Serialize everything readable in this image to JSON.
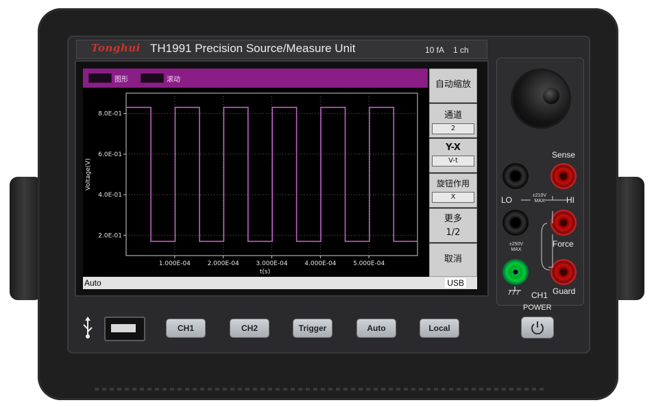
{
  "device": {
    "brand": "Tonghui",
    "model_title": "TH1991 Precision Source/Measure Unit",
    "spec_current": "10 fA",
    "spec_channels": "1 ch"
  },
  "screen": {
    "tabs": [
      {
        "label": "图形"
      },
      {
        "label": "滚动"
      }
    ],
    "status_left": "Auto",
    "status_right": "USB"
  },
  "softkeys": {
    "autoscale": "自动缩放",
    "channel": {
      "label": "通道",
      "value": "2"
    },
    "yx": {
      "label": "Y-X",
      "value": "V-t"
    },
    "knob_function": {
      "label": "旋钮作用",
      "value": "X"
    },
    "more_line1": "更多",
    "more_line2": "1/2",
    "cancel": "取消"
  },
  "chart_data": {
    "type": "line",
    "xlabel": "t(s)",
    "ylabel": "Voltage(V)",
    "x_ticks": [
      "1.000E-04",
      "2.000E-04",
      "3.000E-04",
      "4.000E-04",
      "5.000E-04"
    ],
    "y_ticks": [
      "2.0E-01",
      "4.0E-01",
      "6.0E-01",
      "8.0E-01"
    ],
    "xlim": [
      0,
      0.0006
    ],
    "ylim": [
      0.1,
      0.9
    ],
    "series": [
      {
        "color": "#c062c3",
        "x": [
          0,
          5.1e-05,
          5.1e-05,
          0.000101,
          0.000101,
          0.000151,
          0.000151,
          0.000201,
          0.000201,
          0.000251,
          0.000251,
          0.000301,
          0.000301,
          0.000351,
          0.000351,
          0.000401,
          0.000401,
          0.000451,
          0.000451,
          0.000501,
          0.000501,
          0.000551,
          0.000551,
          0.0006
        ],
        "y": [
          0.83,
          0.83,
          0.17,
          0.17,
          0.83,
          0.83,
          0.17,
          0.17,
          0.83,
          0.83,
          0.17,
          0.17,
          0.83,
          0.83,
          0.17,
          0.17,
          0.83,
          0.83,
          0.17,
          0.17,
          0.83,
          0.83,
          0.17,
          0.17
        ]
      }
    ],
    "grid": true
  },
  "front_panel": {
    "labels": {
      "sense": "Sense",
      "lo": "LO",
      "hi": "HI",
      "v210": "±210V",
      "max": "MAX",
      "v250": "±250V",
      "force": "Force",
      "guard": "Guard",
      "ch1": "CH1",
      "power": "POWER"
    },
    "buttons": [
      "CH1",
      "CH2",
      "Trigger",
      "Auto",
      "Local"
    ]
  }
}
